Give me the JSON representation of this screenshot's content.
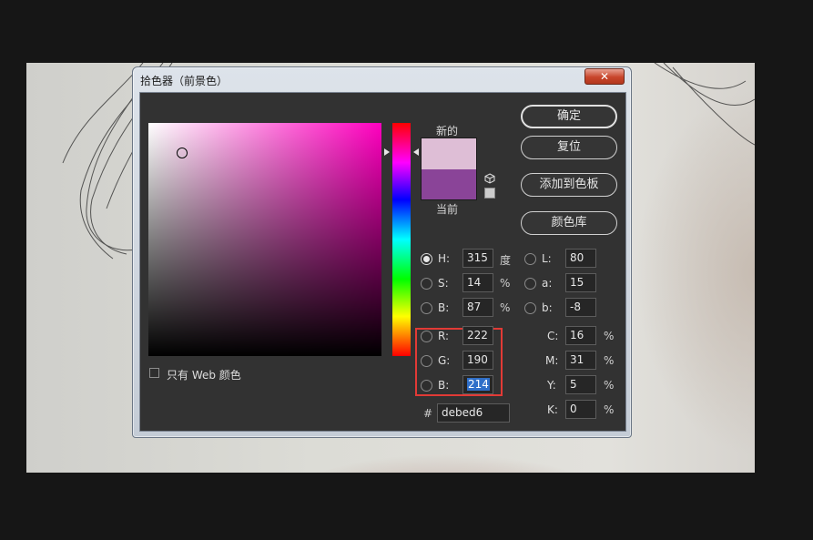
{
  "dialog": {
    "title": "拾色器（前景色）",
    "close_label": "✕"
  },
  "picker": {
    "field_base_color": "#ff00bf",
    "new_label": "新的",
    "current_label": "当前",
    "new_color": "#debed6",
    "current_color": "#8a4498",
    "cube_icon": "websafe-cube-icon"
  },
  "buttons": {
    "ok": "确定",
    "reset": "复位",
    "add_to_swatches": "添加到色板",
    "color_libraries": "颜色库"
  },
  "hsb": {
    "h": {
      "label": "H:",
      "value": "315",
      "unit": "度",
      "selected": true
    },
    "s": {
      "label": "S:",
      "value": "14",
      "unit": "%"
    },
    "b": {
      "label": "B:",
      "value": "87",
      "unit": "%"
    }
  },
  "lab": {
    "l": {
      "label": "L:",
      "value": "80"
    },
    "a": {
      "label": "a:",
      "value": "15"
    },
    "b": {
      "label": "b:",
      "value": "-8"
    }
  },
  "rgb": {
    "r": {
      "label": "R:",
      "value": "222"
    },
    "g": {
      "label": "G:",
      "value": "190"
    },
    "b": {
      "label": "B:",
      "value": "214"
    }
  },
  "cmyk": {
    "c": {
      "label": "C:",
      "value": "16",
      "unit": "%"
    },
    "m": {
      "label": "M:",
      "value": "31",
      "unit": "%"
    },
    "y": {
      "label": "Y:",
      "value": "5",
      "unit": "%"
    },
    "k": {
      "label": "K:",
      "value": "0",
      "unit": "%"
    }
  },
  "hex": {
    "label": "#",
    "value": "debed6"
  },
  "web_only": {
    "label": "只有 Web 颜色",
    "checked": false
  },
  "colors": {
    "highlight": "#e23a36",
    "selection": "#2f6fc9"
  }
}
